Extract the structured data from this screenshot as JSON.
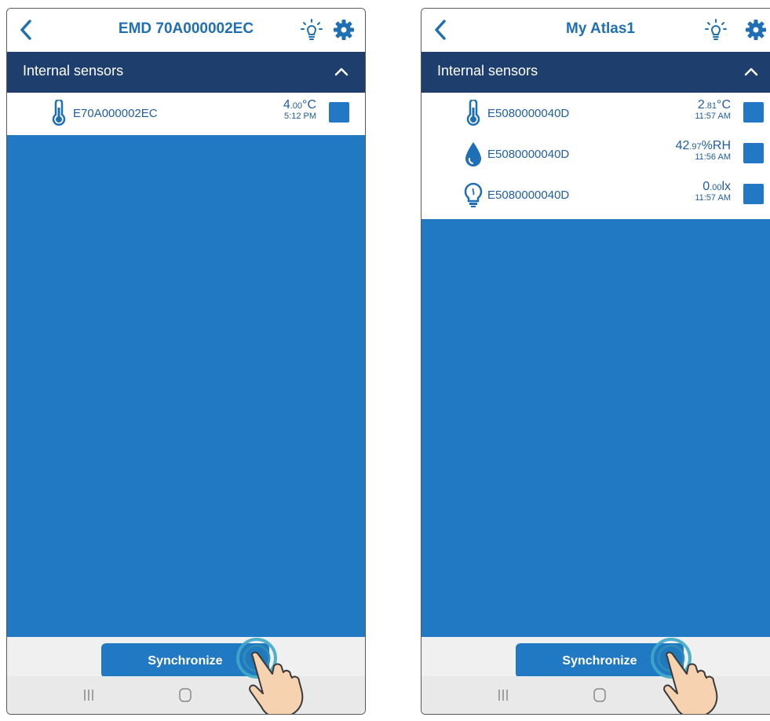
{
  "colors": {
    "brand_blue": "#2178c3",
    "header_navy": "#1e3f6d",
    "text_blue": "#1f5fa3"
  },
  "screens": [
    {
      "title": "EMD 70A000002EC",
      "section_label": "Internal sensors",
      "sensors": [
        {
          "icon": "thermometer-icon",
          "id": "E70A000002EC",
          "value_int": "4",
          "value_dec": ".00",
          "unit": "°C",
          "time": "5:12 PM"
        }
      ],
      "sync_label": "Synchronize"
    },
    {
      "title": "My Atlas1",
      "section_label": "Internal sensors",
      "sensors": [
        {
          "icon": "thermometer-icon",
          "id": "E5080000040D",
          "value_int": "2",
          "value_dec": ".81",
          "unit": "°C",
          "time": "11:57 AM"
        },
        {
          "icon": "humidity-drop-icon",
          "id": "E5080000040D",
          "value_int": "42",
          "value_dec": ".97",
          "unit": "%RH",
          "time": "11:56 AM"
        },
        {
          "icon": "light-bulb-icon",
          "id": "E5080000040D",
          "value_int": "0",
          "value_dec": ".00",
          "unit": "lx",
          "time": "11:57 AM"
        }
      ],
      "sync_label": "Synchronize"
    }
  ]
}
